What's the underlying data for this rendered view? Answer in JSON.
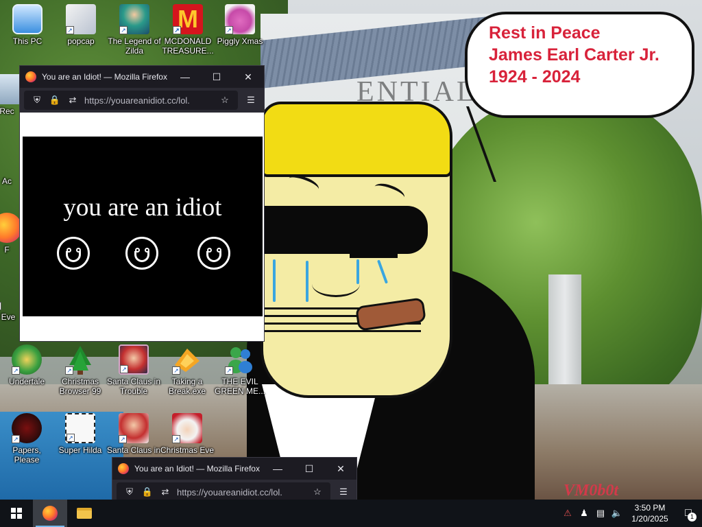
{
  "bubble": {
    "line1": "Rest in Peace",
    "line2": "James Earl Carter Jr.",
    "line3": "1924 - 2024"
  },
  "wallpaper": {
    "sign_text": "ENTIAL",
    "watermark": "VM0b0t"
  },
  "desktop_icons": [
    {
      "label": "This PC",
      "icon": "computer-icon"
    },
    {
      "label": "popcap",
      "icon": "popcap-icon"
    },
    {
      "label": "The Legend of Zilda",
      "icon": "zilda-icon"
    },
    {
      "label": "MCDONALD TREASURE...",
      "icon": "mcdonalds-icon"
    },
    {
      "label": "Piggly Xmas",
      "icon": "piggly-icon"
    },
    {
      "label": "Rec",
      "icon": "recycle-bin-icon"
    },
    {
      "label": "Ac",
      "icon": "app-icon"
    },
    {
      "label": "F",
      "icon": "firefox-icon"
    },
    {
      "label": "Eve",
      "icon": "app-icon"
    },
    {
      "label": "Undertale",
      "icon": "undertale-icon"
    },
    {
      "label": "Christmas Browser 99",
      "icon": "christmas-tree-icon"
    },
    {
      "label": "Santa Claus in Trouble",
      "icon": "santa-icon"
    },
    {
      "label": "Taking a Break.exe",
      "icon": "break-icon"
    },
    {
      "label": "THE EVIL GREEN ME...",
      "icon": "messenger-icon"
    },
    {
      "label": "Papers, Please",
      "icon": "papers-please-icon"
    },
    {
      "label": "Super Hilda",
      "icon": "hilda-icon"
    },
    {
      "label": "Santa Claus in",
      "icon": "santa-icon"
    },
    {
      "label": "Christmas Eve",
      "icon": "santa-face-icon"
    }
  ],
  "window_main": {
    "title": "You are an Idiot! — Mozilla Firefox",
    "url": "https://youareanidiot.cc/lol.",
    "page_text": "you are an idiot"
  },
  "window_second": {
    "title": "You are an Idiot! — Mozilla Firefox",
    "url": "https://youareanidiot.cc/lol."
  },
  "taskbar": {
    "time": "3:50 PM",
    "date": "1/20/2025",
    "notification_count": "1"
  }
}
